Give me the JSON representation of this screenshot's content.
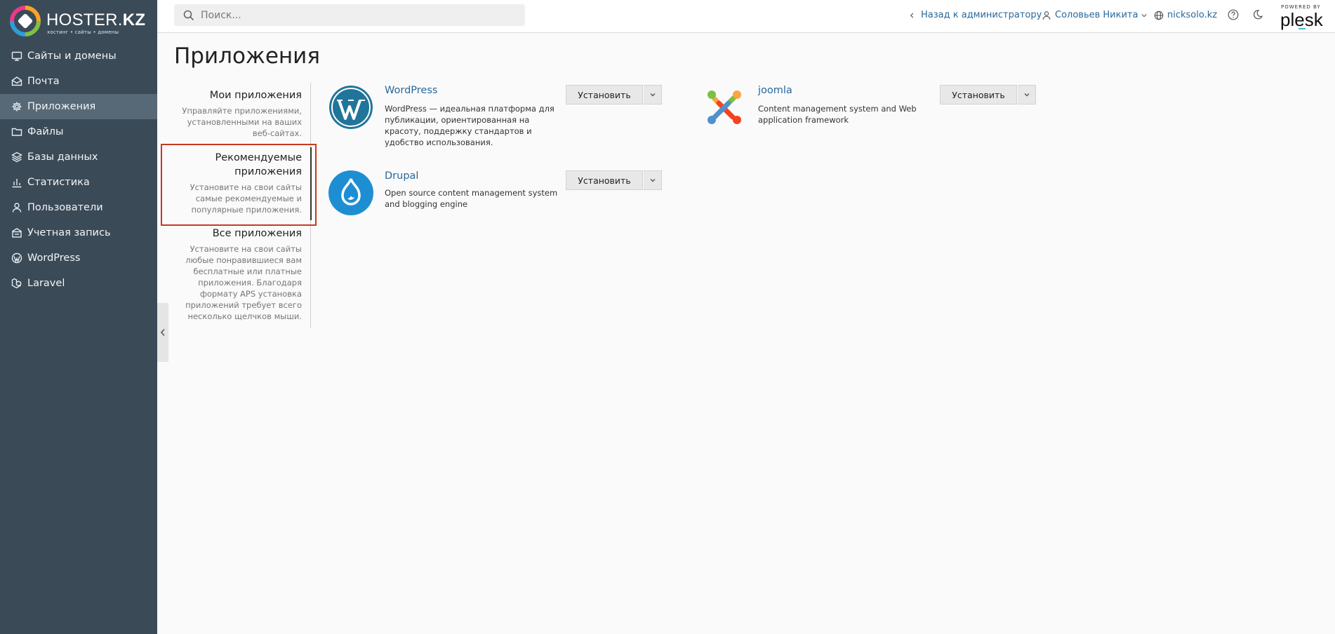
{
  "brand": {
    "name_light": "HOSTER.",
    "name_bold": "KZ",
    "tagline": "хостинг • сайты • домены"
  },
  "sidebar": {
    "items": [
      {
        "label": "Сайты и домены",
        "icon": "monitor-icon"
      },
      {
        "label": "Почта",
        "icon": "mail-icon"
      },
      {
        "label": "Приложения",
        "icon": "gear-icon",
        "active": true
      },
      {
        "label": "Файлы",
        "icon": "folder-icon"
      },
      {
        "label": "Базы данных",
        "icon": "database-icon"
      },
      {
        "label": "Статистика",
        "icon": "bar-chart-icon"
      },
      {
        "label": "Пользователи",
        "icon": "user-icon"
      },
      {
        "label": "Учетная запись",
        "icon": "account-icon"
      },
      {
        "label": "WordPress",
        "icon": "wordpress-icon"
      },
      {
        "label": "Laravel",
        "icon": "laravel-icon"
      }
    ]
  },
  "header": {
    "search_placeholder": "Поиск...",
    "back_link": "Назад к администратору",
    "user_name": "Соловьев Никита",
    "domain": "nicksolo.kz",
    "powered_by": "POWERED BY",
    "plesk": "plesk"
  },
  "page": {
    "title": "Приложения"
  },
  "tabs": [
    {
      "title": "Мои приложения",
      "desc": "Управляйте приложениями, установленными на ваших веб-сайтах."
    },
    {
      "title": "Рекомендуемые приложения",
      "desc": "Установите на свои сайты самые рекомендуемые и популярные приложения.",
      "active": true
    },
    {
      "title": "Все приложения",
      "desc": "Установите на свои сайты любые понравившиеся вам бесплатные или платные приложения. Благодаря формату APS установка приложений требует всего несколько щелчков мыши."
    }
  ],
  "apps": [
    {
      "name": "WordPress",
      "desc": "WordPress — идеальная платформа для публикации, ориентированная на красоту, поддержку стандартов и удобство использования.",
      "install": "Установить"
    },
    {
      "name": "joomla",
      "desc": "Content management system and Web application framework",
      "install": "Установить"
    },
    {
      "name": "Drupal",
      "desc": "Open source content management system and blogging engine",
      "install": "Установить"
    }
  ],
  "colors": {
    "sidebar_bg": "#3b4a57",
    "sidebar_active": "#576876",
    "link": "#28689b",
    "highlight": "#c9391c"
  }
}
